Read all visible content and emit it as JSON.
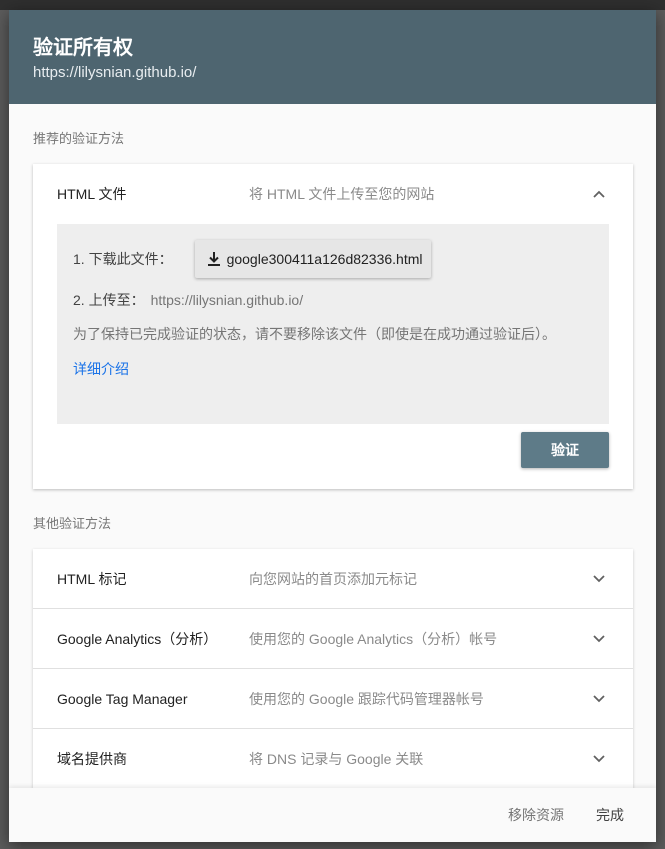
{
  "dialog": {
    "title": "验证所有权",
    "url": "https://lilysnian.github.io/"
  },
  "recommended": {
    "section_label": "推荐的验证方法",
    "method_name": "HTML 文件",
    "method_desc": "将 HTML 文件上传至您的网站",
    "step1_label": "1. 下载此文件：",
    "download_file": "google300411a126d82336.html",
    "step2_label": "2. 上传至：",
    "step2_url": "https://lilysnian.github.io/",
    "note": "为了保持已完成验证的状态，请不要移除该文件（即使是在成功通过验证后）。",
    "learn_more": "详细介绍",
    "verify_label": "验证"
  },
  "other": {
    "section_label": "其他验证方法",
    "methods": [
      {
        "name": "HTML 标记",
        "desc": "向您网站的首页添加元标记"
      },
      {
        "name": "Google Analytics（分析）",
        "desc": "使用您的 Google Analytics（分析）帐号"
      },
      {
        "name": "Google Tag Manager",
        "desc": "使用您的 Google 跟踪代码管理器帐号"
      },
      {
        "name": "域名提供商",
        "desc": "将 DNS 记录与 Google 关联"
      }
    ]
  },
  "footer": {
    "remove_label": "移除资源",
    "done_label": "完成"
  },
  "icons": {
    "expand": "chevron-up-icon",
    "collapse": "chevron-down-icon",
    "download": "download-icon"
  },
  "colors": {
    "header": "#4e6570",
    "verify_button": "#5e7b88",
    "link": "#1a73e8"
  }
}
